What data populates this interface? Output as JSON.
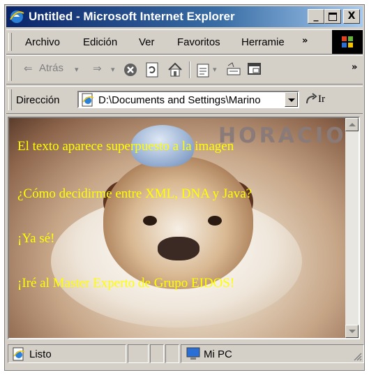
{
  "window": {
    "title": "Untitled - Microsoft Internet Explorer"
  },
  "title_buttons": {
    "minimize": "_",
    "close": "X"
  },
  "menu": {
    "items": [
      "Archivo",
      "Edición",
      "Ver",
      "Favoritos",
      "Herramie"
    ],
    "overflow": "»"
  },
  "toolbar": {
    "back_label": "Atrás",
    "overflow": "»"
  },
  "address": {
    "label": "Dirección",
    "value": "D:\\Documents and Settings\\Marino",
    "go_label": "Ir"
  },
  "page": {
    "image_caption": "HORACIO",
    "lines": [
      "El texto aparece superpuesto a la imagen",
      "¿Cómo decidirme entre XML, DNA y Java?",
      "¡Ya sé!",
      "¡Iré al Master Experto de Grupo EIDOS!"
    ]
  },
  "status": {
    "text": "Listo",
    "zone": "Mi PC"
  },
  "colors": {
    "title_bar": "#0a246a",
    "page_text": "#ffff00",
    "chrome": "#d4d0c8"
  }
}
